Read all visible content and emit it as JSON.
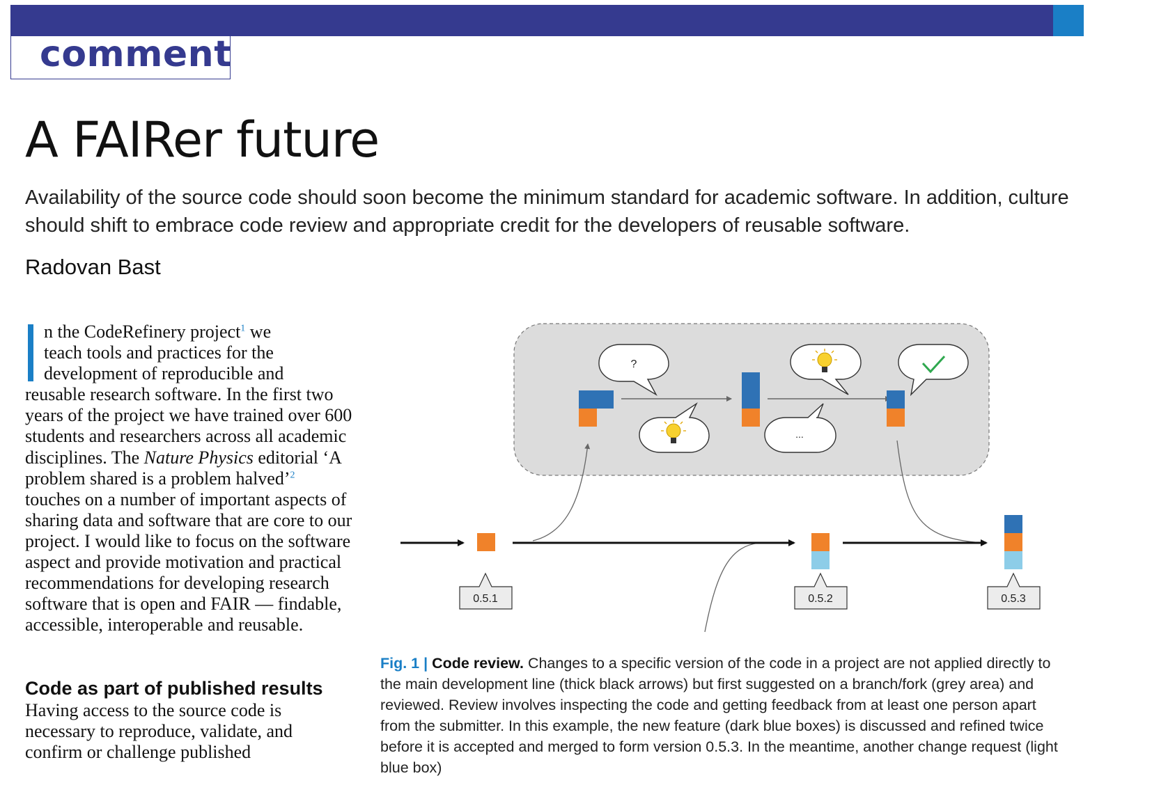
{
  "header": {
    "section": "comment"
  },
  "article": {
    "title": "A FAIRer future",
    "standfirst": "Availability of the source code should soon become the minimum standard for academic software. In addition, culture should shift to embrace code review and appropriate credit for the developers of reusable software.",
    "author": "Radovan Bast"
  },
  "body": {
    "p1_line1": "n the CodeRefinery project",
    "ref1": "1",
    "p1_line1_end": " we",
    "p1_line2": "teach tools and practices for the",
    "p1_line3": "development of reproducible and",
    "p1_rest_a": "reusable research software. In the first two years of the project we have trained over 600 students and researchers across all academic disciplines. The ",
    "p1_italic": "Nature Physics",
    "p1_rest_b": " editorial ‘A problem shared is a problem halved’",
    "ref2": "2",
    "p1_rest_c": " touches on a number of important aspects of sharing data and software that are core to our project. I would like to focus on the software aspect and provide motivation and practical recommendations for developing research software that is open and FAIR — findable, accessible, interoperable and reusable.",
    "subhead": "Code as part of published results",
    "p2": "Having access to the source code is necessary to reproduce, validate, and confirm or challenge published"
  },
  "figure": {
    "versions": [
      "0.5.1",
      "0.5.2",
      "0.5.3"
    ],
    "bubble_question": "?",
    "bubble_ellipsis": "...",
    "colors": {
      "dark_blue": "#2f72b5",
      "orange": "#f0822a",
      "light_blue": "#8dcde8",
      "grey_area": "#dcdcdc"
    },
    "icons": [
      "lightbulb-icon",
      "lightbulb-icon",
      "checkmark-icon"
    ]
  },
  "caption": {
    "label": "Fig. 1 |",
    "title": "Code review.",
    "text": " Changes to a specific version of the code in a project are not applied directly to the main development line (thick black arrows) but first suggested on a branch/fork (grey area) and reviewed. Review involves inspecting the code and getting feedback from at least one person apart from the submitter. In this example, the new feature (dark blue boxes) is discussed and refined twice before it is accepted and merged to form version 0.5.3. In the meantime, another change request (light blue box)"
  }
}
